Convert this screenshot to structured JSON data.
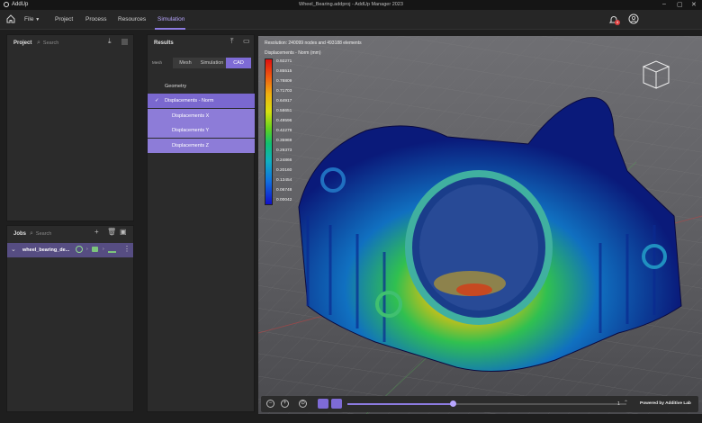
{
  "app": {
    "name": "AddUp",
    "window_title": "Wheel_Bearing.addproj - AddUp Manager 2023",
    "notification_count": "4"
  },
  "menu": {
    "file": "File",
    "project": "Project",
    "process": "Process",
    "resources": "Resources",
    "simulation": "Simulation"
  },
  "project_panel": {
    "title": "Project",
    "search_placeholder": "Search"
  },
  "jobs_panel": {
    "title": "Jobs",
    "search_placeholder": "Search",
    "job_name": "wheel_bearing_de..."
  },
  "results_panel": {
    "title": "Results",
    "mesh_label": "Mesh",
    "tabs": [
      "Mesh",
      "Simulation",
      "CAD"
    ],
    "active_tab": "CAD",
    "items": [
      {
        "label": "Geometry"
      },
      {
        "label": "Displacements - Norm",
        "check": "✓"
      },
      {
        "label": "Displacements X"
      },
      {
        "label": "Displacements Y"
      },
      {
        "label": "Displacements Z"
      }
    ]
  },
  "viewport": {
    "resolution_text": "Resolution: 240099 nodes and 493188 elements",
    "legend_title": "Displacements - Norm (mm)",
    "legend_values": [
      "0.92271",
      "0.85515",
      "0.78809",
      "0.71703",
      "0.64917",
      "0.58651",
      "0.49596",
      "0.42279",
      "0.35969",
      "0.29373",
      "0.24866",
      "0.20160",
      "0.13454",
      "0.06748",
      "0.00042"
    ],
    "page_indicator": "1",
    "powered_by": "Powered by Additive Lab"
  },
  "colors": {
    "accent": "#8c7be0",
    "selection": "#7a68cf"
  }
}
